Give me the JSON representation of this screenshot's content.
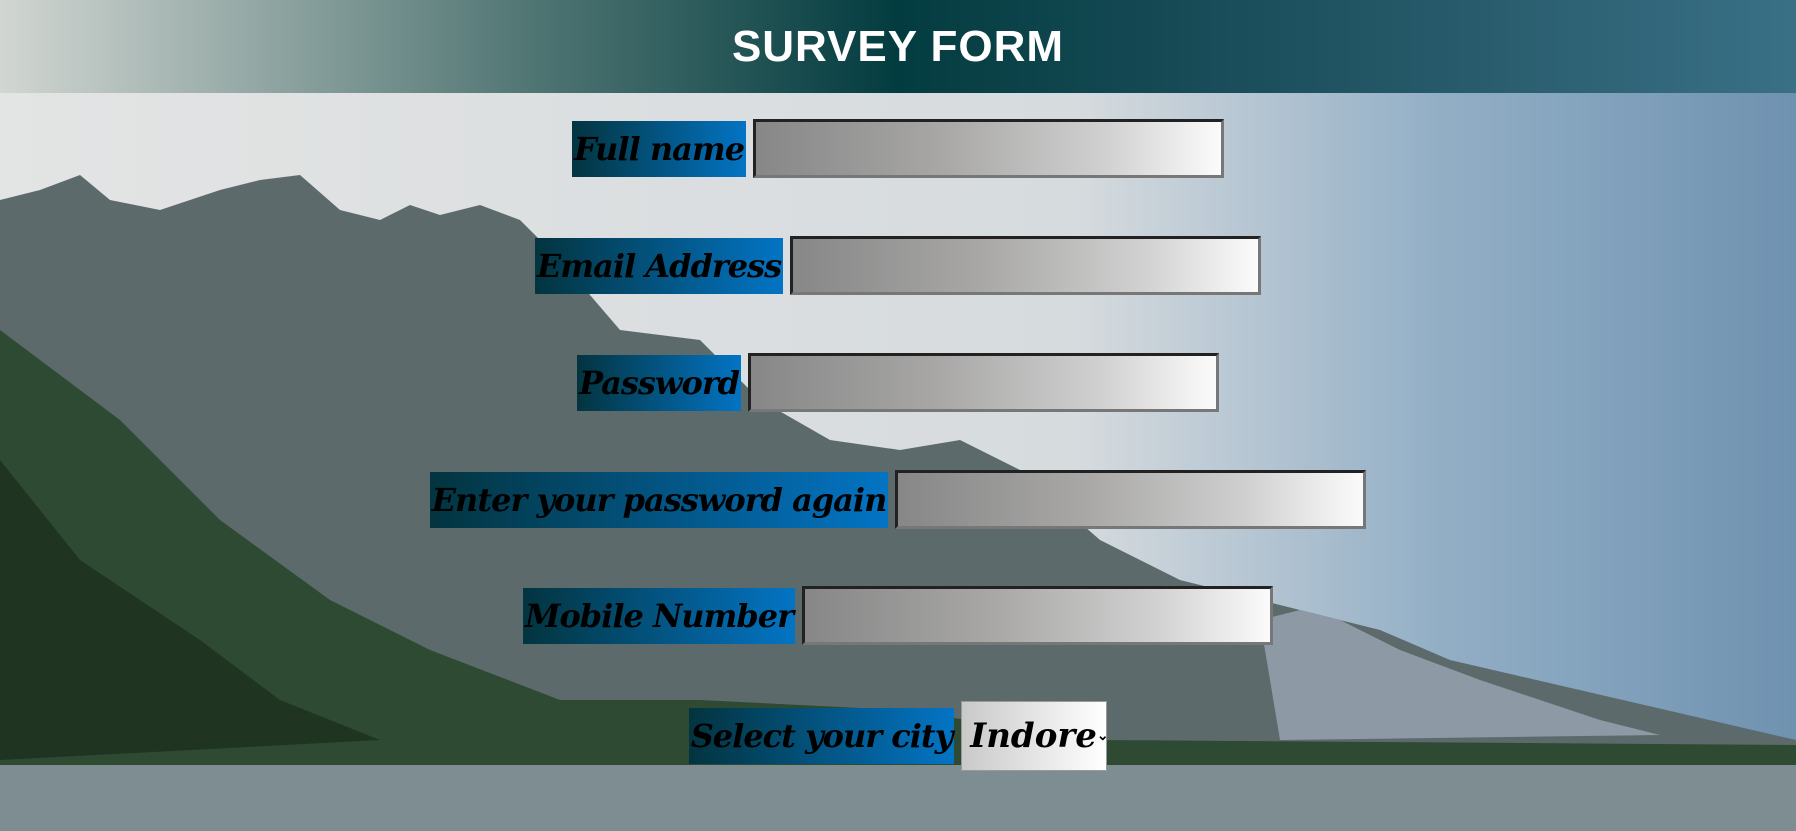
{
  "header": {
    "title": "SURVEY FORM"
  },
  "form": {
    "fields": [
      {
        "label": "Full name",
        "value": ""
      },
      {
        "label": "Email Address",
        "value": ""
      },
      {
        "label": "Password",
        "value": ""
      },
      {
        "label": "Enter your password again",
        "value": ""
      },
      {
        "label": "Mobile Number",
        "value": ""
      }
    ],
    "city": {
      "label": "Select your city",
      "selected": "Indore"
    }
  }
}
